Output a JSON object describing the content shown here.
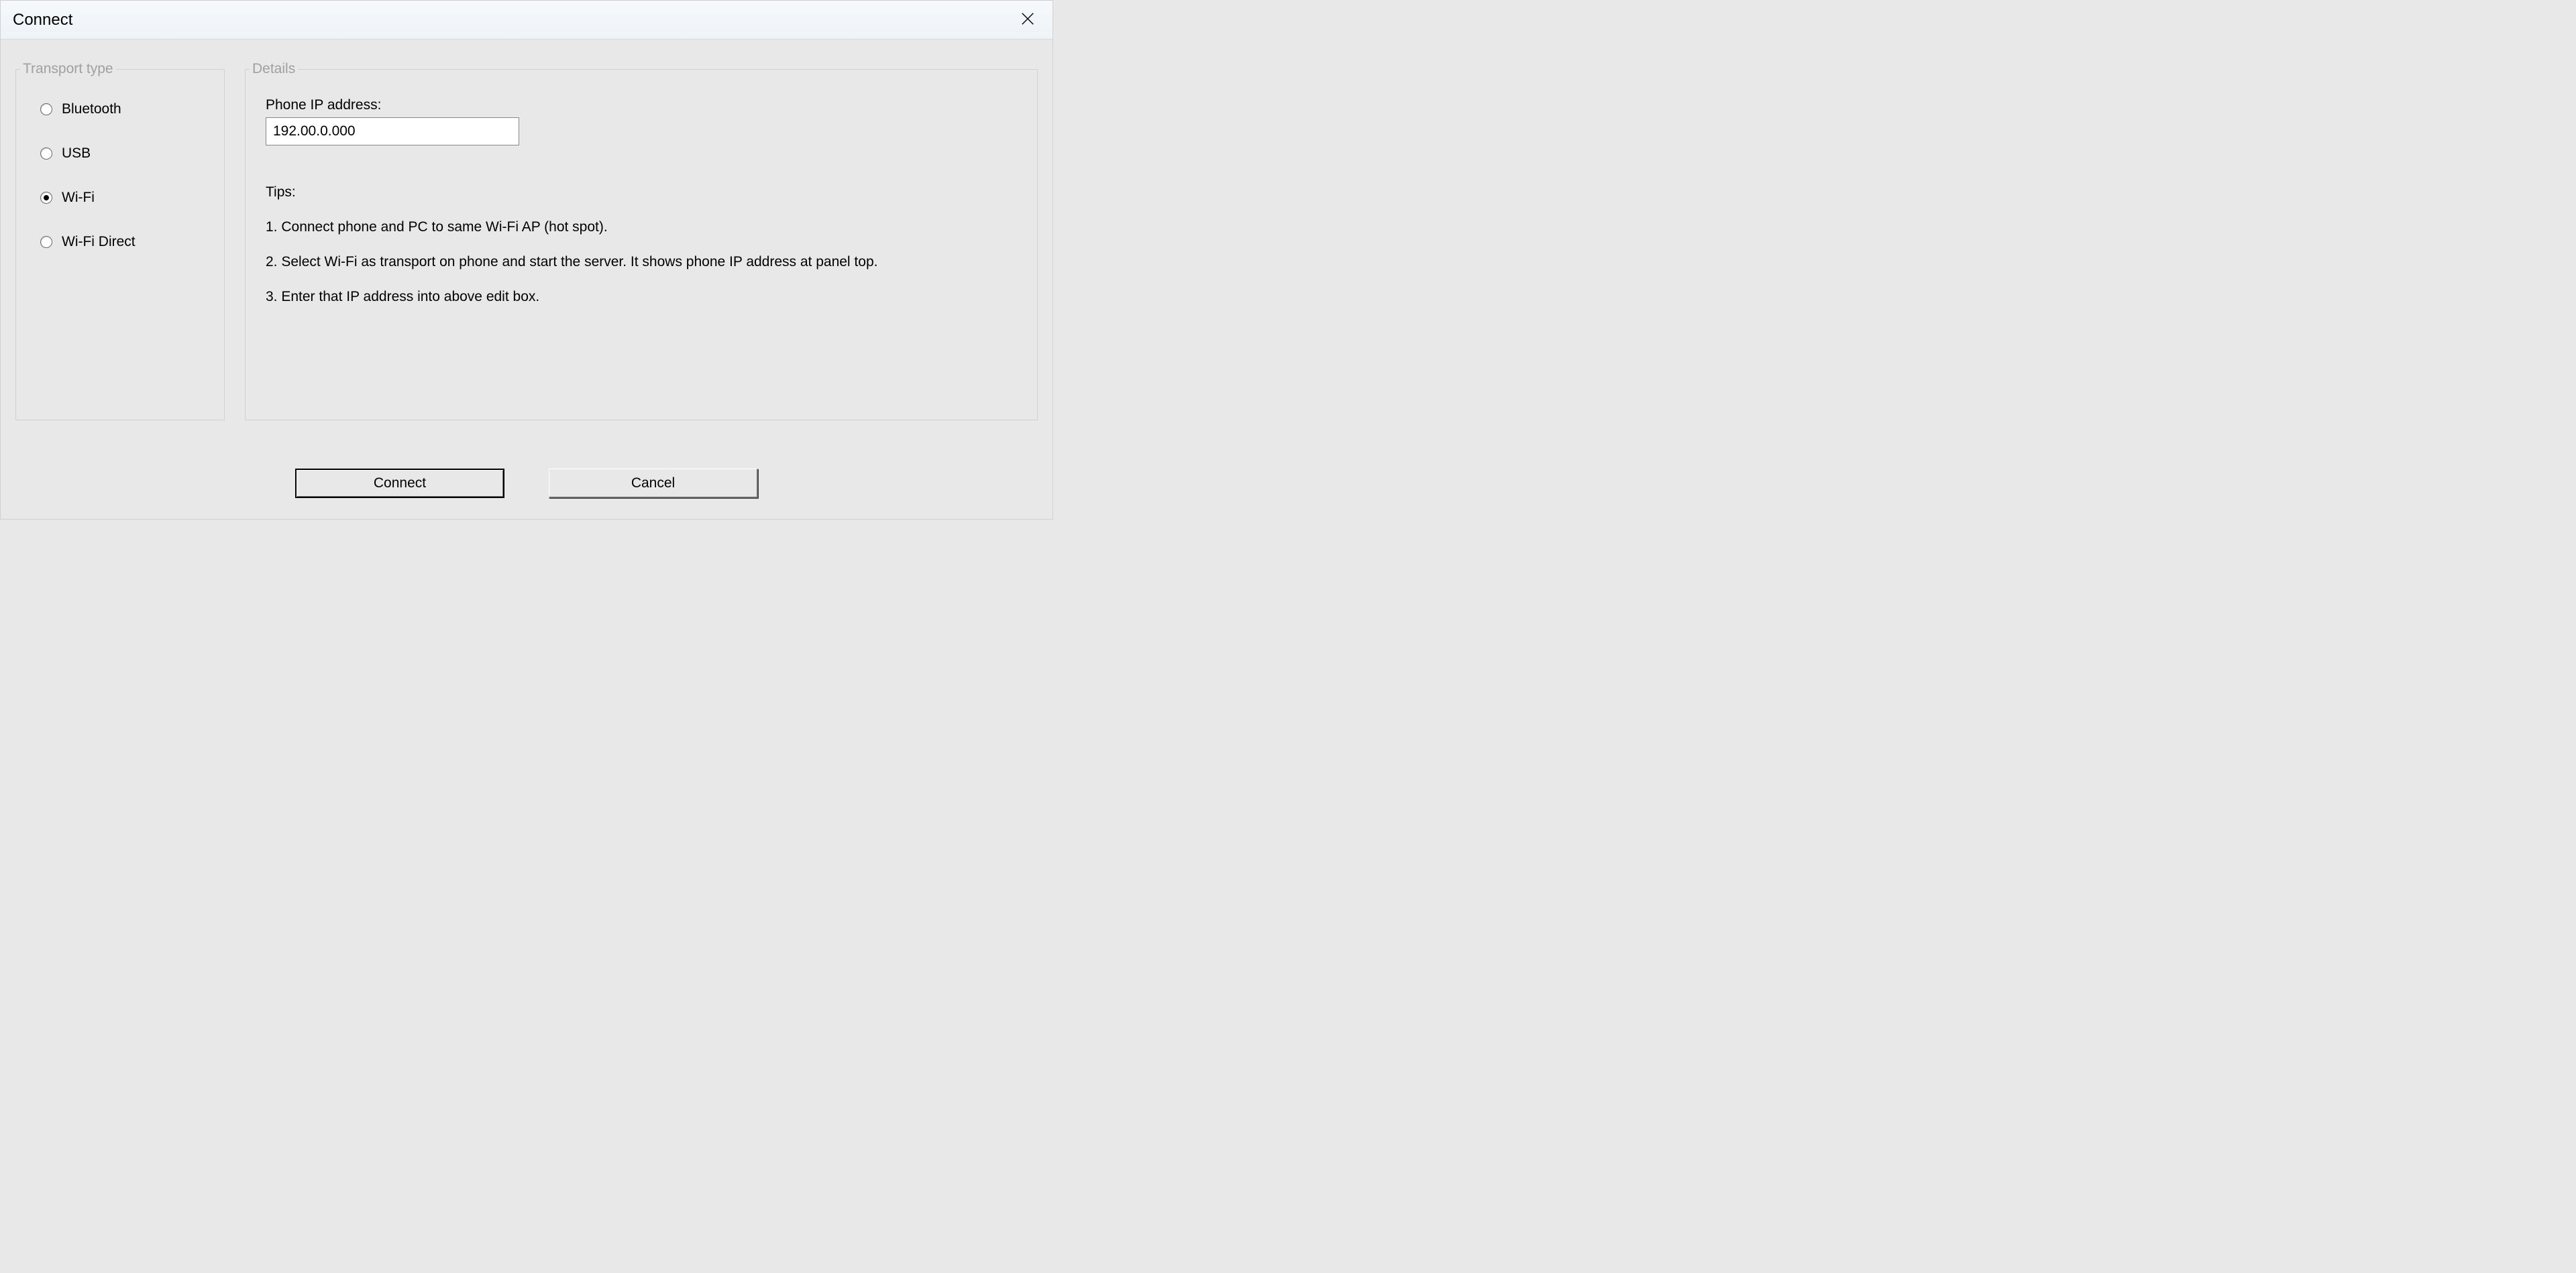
{
  "window": {
    "title": "Connect"
  },
  "transport": {
    "legend": "Transport type",
    "options": {
      "bluetooth": "Bluetooth",
      "usb": "USB",
      "wifi": "Wi-Fi",
      "wifi_direct": "Wi-Fi Direct"
    },
    "selected": "wifi"
  },
  "details": {
    "legend": "Details",
    "ip_label": "Phone IP address:",
    "ip_value": "192.00.0.000",
    "tips_header": "Tips:",
    "tips": {
      "t1": "1. Connect phone and PC to same Wi-Fi AP (hot spot).",
      "t2": "2. Select Wi-Fi as transport on phone and start the server. It shows phone IP address at panel top.",
      "t3": "3. Enter that IP address into above edit box."
    }
  },
  "buttons": {
    "connect": "Connect",
    "cancel": "Cancel"
  }
}
